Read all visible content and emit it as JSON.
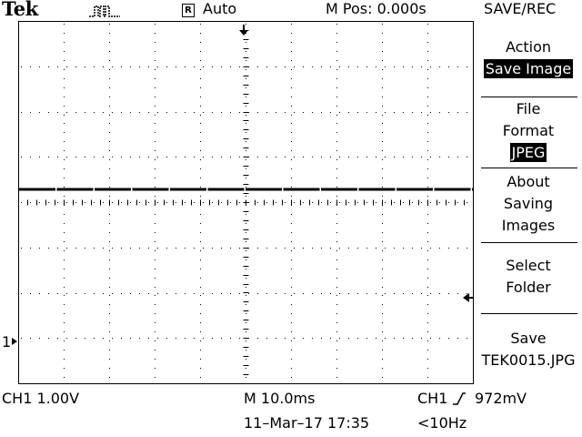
{
  "header": {
    "brand": "Tek",
    "acquisition_mode": "Auto",
    "run_status_glyph": "R",
    "main_position": "M Pos: 0.000s",
    "menu_title": "SAVE/REC"
  },
  "menu": {
    "action_label": "Action",
    "action_value": "Save Image",
    "format_label_1": "File",
    "format_label_2": "Format",
    "format_value": "JPEG",
    "about_1": "About",
    "about_2": "Saving",
    "about_3": "Images",
    "select_1": "Select",
    "select_2": "Folder",
    "save_label": "Save",
    "save_file": "TEK0015.JPG"
  },
  "status": {
    "ch1_scale": "CH1  1.00V",
    "timebase": "M 10.0ms",
    "datetime": "11–Mar–17 17:35",
    "trigger_source": "CH1",
    "trigger_level": "972mV",
    "trigger_freq": "<10Hz"
  },
  "markers": {
    "ch1_ground": "1"
  },
  "colors": {
    "background": "#ffffff",
    "foreground": "#000000"
  }
}
